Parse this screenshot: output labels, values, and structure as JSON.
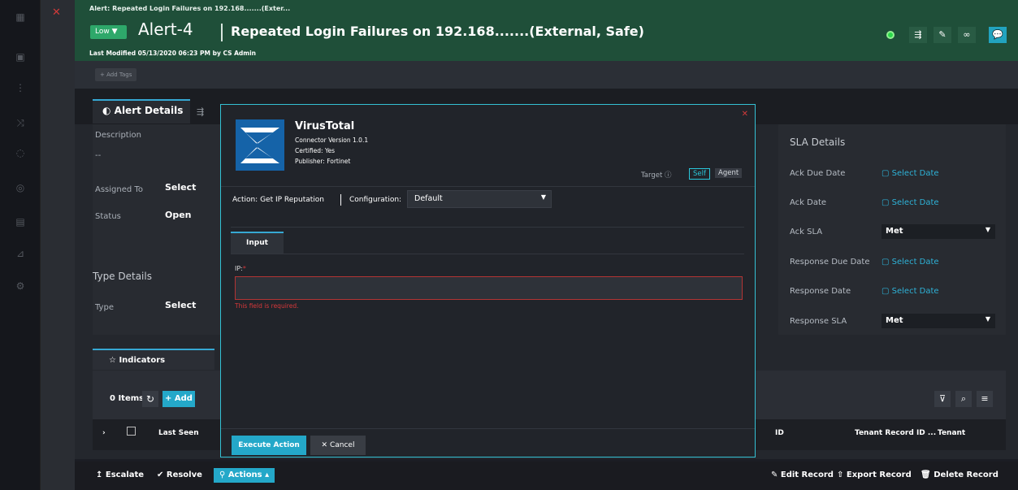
{
  "header": {
    "crumb": "Alert: Repeated Login Failures on 192.168.......(Exter...",
    "severity": "Low ▼",
    "alert_id": "Alert-4",
    "title": "Repeated Login Failures on 192.168.......(External, Safe)",
    "modified": "Last Modified 05/13/2020 06:23 PM by CS Admin"
  },
  "tags": {
    "add_label": "+ Add Tags"
  },
  "tabs": {
    "details": "Alert Details",
    "indicators": "Indicators"
  },
  "details": {
    "description_label": "Description",
    "description_value": "--",
    "assigned_label": "Assigned To",
    "assigned_value": "Select",
    "status_label": "Status",
    "status_value": "Open",
    "type_header": "Type Details",
    "type_label": "Type",
    "type_value": "Select"
  },
  "sla": {
    "header": "SLA Details",
    "rows": [
      {
        "label": "Ack Due Date",
        "value": "Select Date"
      },
      {
        "label": "Ack Date",
        "value": "Select Date"
      },
      {
        "label": "Ack SLA",
        "value": "Met"
      },
      {
        "label": "Response Due Date",
        "value": "Select Date"
      },
      {
        "label": "Response Date",
        "value": "Select Date"
      },
      {
        "label": "Response SLA",
        "value": "Met"
      }
    ]
  },
  "indicators": {
    "count": "0 Items",
    "add": "+ Add",
    "headers": [
      "Last Seen",
      "ID",
      "Tenant Record ID ...",
      "Tenant"
    ]
  },
  "footer": {
    "escalate": "Escalate",
    "resolve": "Resolve",
    "actions": "Actions",
    "edit": "Edit Record",
    "export": "Export Record",
    "delete": "Delete Record"
  },
  "modal": {
    "title": "VirusTotal",
    "version": "Connector Version 1.0.1",
    "certified": "Certified: Yes",
    "publisher": "Publisher: Fortinet",
    "target_label": "Target",
    "self": "Self",
    "agent": "Agent",
    "action": "Action: Get IP Reputation",
    "configuration_label": "Configuration:",
    "configuration_value": "Default",
    "input_tab": "Input",
    "ip_label": "IP:",
    "error": "This field is required.",
    "execute": "Execute Action",
    "cancel": "Cancel"
  },
  "colors": {
    "accent": "#24a8c9",
    "header": "#1f4f39",
    "error": "#d6383a"
  }
}
